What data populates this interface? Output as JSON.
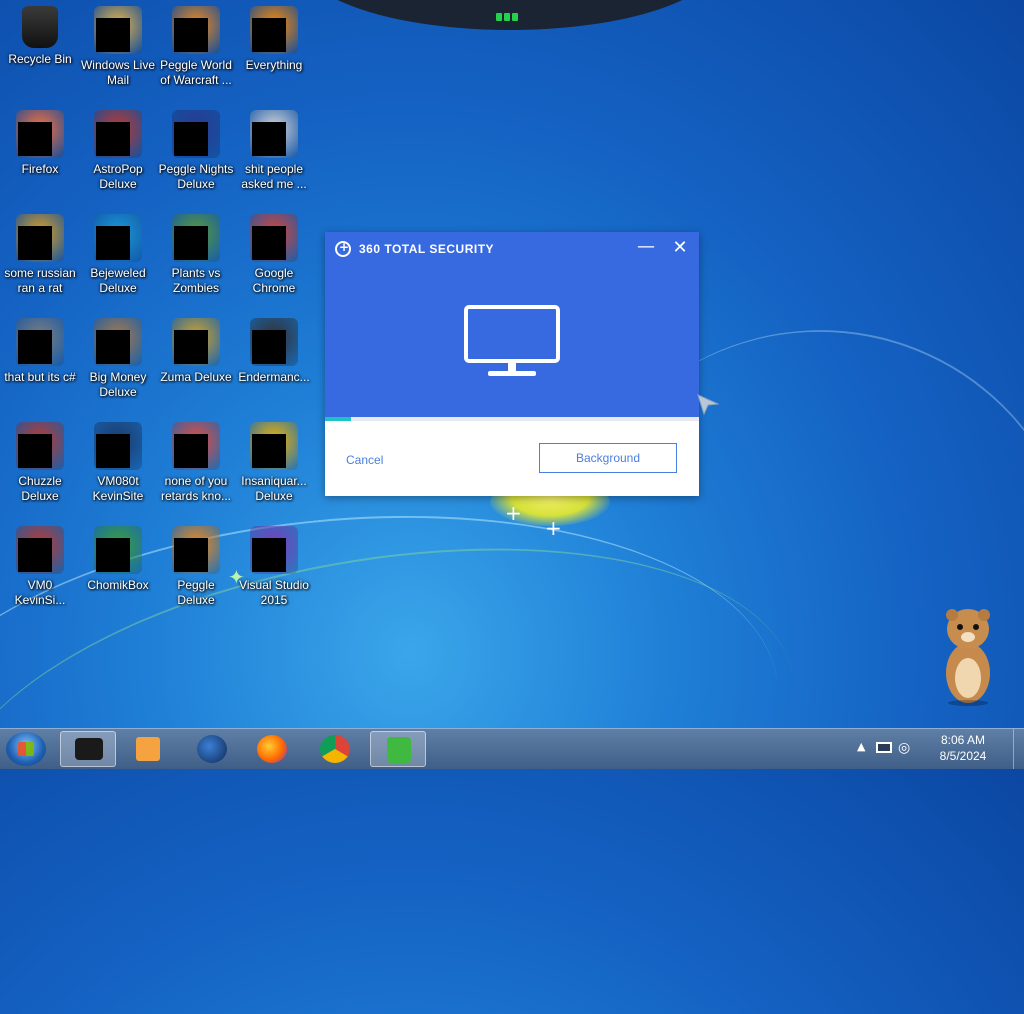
{
  "desktop": {
    "icons": [
      {
        "label": "Recycle Bin",
        "icon": "recycle-bin-icon"
      },
      {
        "label": "Windows Live Mail",
        "icon": "windows-live-mail-icon"
      },
      {
        "label": "Peggle World of Warcraft ...",
        "icon": "peggle-wow-icon"
      },
      {
        "label": "Everything",
        "icon": "everything-icon"
      },
      {
        "label": "Firefox",
        "icon": "firefox-icon"
      },
      {
        "label": "AstroPop Deluxe",
        "icon": "astropop-icon"
      },
      {
        "label": "Peggle Nights Deluxe",
        "icon": "peggle-nights-icon"
      },
      {
        "label": "shit people asked me ...",
        "icon": "folder-icon"
      },
      {
        "label": "some russian ran a rat",
        "icon": "file-icon"
      },
      {
        "label": "Bejeweled Deluxe",
        "icon": "bejeweled-icon"
      },
      {
        "label": "Plants vs Zombies",
        "icon": "pvz-icon"
      },
      {
        "label": "Google Chrome",
        "icon": "chrome-icon"
      },
      {
        "label": "that but its c#",
        "icon": "shortcut-icon"
      },
      {
        "label": "Big Money Deluxe",
        "icon": "big-money-icon"
      },
      {
        "label": "Zuma Deluxe",
        "icon": "zuma-icon"
      },
      {
        "label": "Endermanc...",
        "icon": "app-icon"
      },
      {
        "label": "Chuzzle Deluxe",
        "icon": "chuzzle-icon"
      },
      {
        "label": "VM080t KevinSite",
        "icon": "vm-icon"
      },
      {
        "label": "none of you retards kno...",
        "icon": "shortcut-icon"
      },
      {
        "label": "Insaniquar... Deluxe",
        "icon": "insaniquarium-icon"
      },
      {
        "label": "VM0 KevinSi...",
        "icon": "vm-icon"
      },
      {
        "label": "ChomikBox",
        "icon": "chomikbox-icon"
      },
      {
        "label": "Peggle Deluxe",
        "icon": "peggle-icon"
      },
      {
        "label": "Visual Studio 2015",
        "icon": "visual-studio-icon"
      }
    ]
  },
  "dialog": {
    "app_name": "360 TOTAL SECURITY",
    "minimize_label": "—",
    "close_label": "✕",
    "progress": 0.07,
    "cancel_label": "Cancel",
    "background_label": "Background",
    "accent": "#3769e0",
    "progress_color": "#1fc1c3"
  },
  "taskbar": {
    "buttons": [
      "start-button",
      "explorer-window",
      "media-player",
      "app-globe",
      "firefox",
      "chrome",
      "360-total-security"
    ],
    "tray": {
      "time": "8:06 AM",
      "date": "8/5/2024"
    }
  }
}
